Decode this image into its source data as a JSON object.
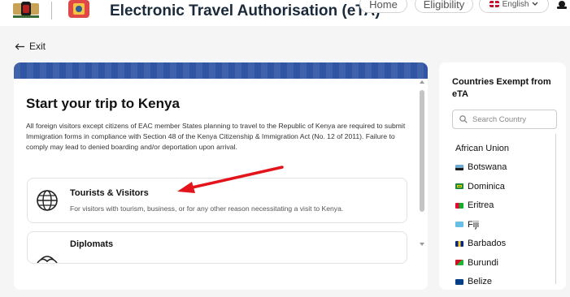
{
  "header": {
    "title": "Electronic Travel Authorisation (eTA)",
    "nav": {
      "home": "Home",
      "eligibility": "Eligibility",
      "language": "English"
    }
  },
  "exit_label": "Exit",
  "main": {
    "title": "Start your trip to Kenya",
    "intro": "All foreign visitors except citizens of EAC member States planning to travel to the Republic of Kenya are required to submit Immigration forms in compliance with Section 48 of the Kenya Citizenship & Immigration Act (No. 12 of 2011). Failure to comply may lead to denied boarding and/or deportation upon arrival.",
    "options": [
      {
        "title": "Tourists & Visitors",
        "description": "For visitors with tourism, business, or for any other reason necessitating a visit to Kenya.",
        "icon": "globe-icon"
      },
      {
        "title": "Diplomats",
        "description": "",
        "icon": "diplomat-icon"
      }
    ]
  },
  "sidebar": {
    "title": "Countries Exempt from eTA",
    "search_placeholder": "Search Country",
    "countries": [
      {
        "name": "African Union",
        "flag": null
      },
      {
        "name": "Botswana",
        "flag": "#6da9d2"
      },
      {
        "name": "Dominica",
        "flag": "#1b8a3e"
      },
      {
        "name": "Eritrea",
        "flag": "#ea0437"
      },
      {
        "name": "Fiji",
        "flag": "#68bfe5"
      },
      {
        "name": "Barbados",
        "flag": "#00267f"
      },
      {
        "name": "Burundi",
        "flag": "#ce1126"
      },
      {
        "name": "Belize",
        "flag": "#003f87"
      }
    ]
  },
  "colors": {
    "banner": "#2f55a4",
    "annotation_arrow": "#e3141b"
  }
}
